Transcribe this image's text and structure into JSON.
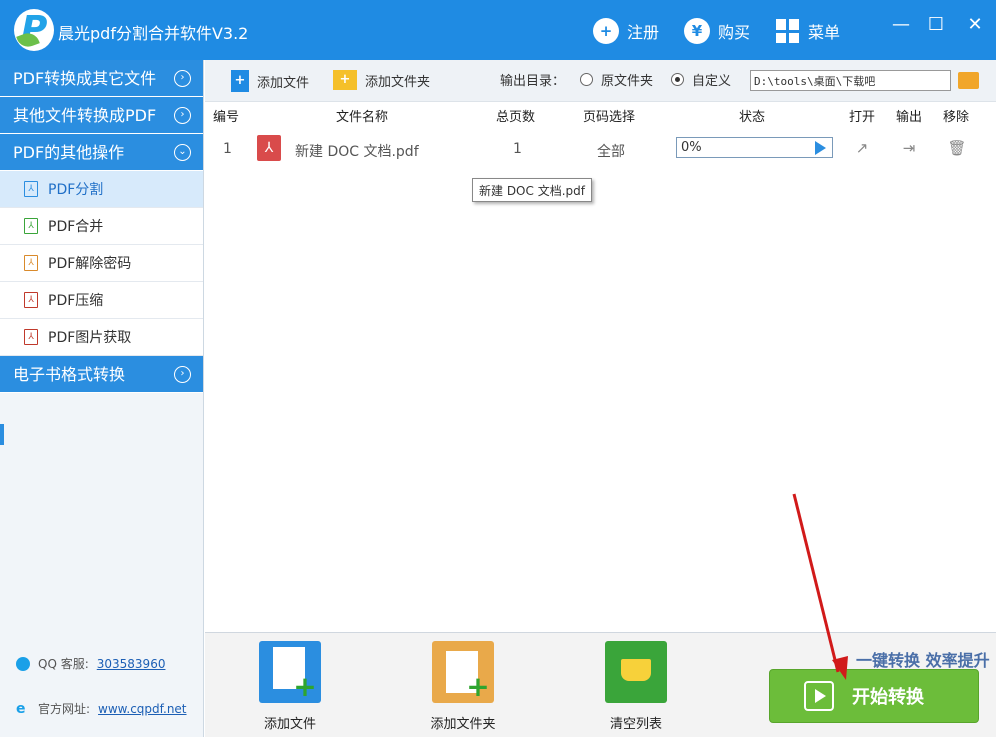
{
  "titlebar": {
    "title": "晨光pdf分割合并软件V3.2",
    "register": "注册",
    "buy": "购买",
    "menu": "菜单",
    "minimize": "—",
    "maximize": "☐",
    "close": "✕"
  },
  "sidebar": {
    "sections": [
      {
        "label": "PDF转换成其它文件"
      },
      {
        "label": "其他文件转换成PDF"
      },
      {
        "label": "PDF的其他操作"
      }
    ],
    "items": [
      {
        "label": "PDF分割"
      },
      {
        "label": "PDF合并"
      },
      {
        "label": "PDF解除密码"
      },
      {
        "label": "PDF压缩"
      },
      {
        "label": "PDF图片获取"
      }
    ],
    "ebook": {
      "label": "电子书格式转换"
    },
    "qq_label": "QQ 客服:",
    "qq_value": "303583960",
    "site_label": "官方网址:",
    "site_value": "www.cqpdf.net"
  },
  "toolbar": {
    "add_file": "添加文件",
    "add_folder": "添加文件夹",
    "output_label": "输出目录：",
    "option_original": "原文件夹",
    "option_custom": "自定义",
    "output_path": "D:\\tools\\桌面\\下载吧"
  },
  "table": {
    "headers": {
      "index": "编号",
      "name": "文件名称",
      "pages": "总页数",
      "range": "页码选择",
      "status": "状态",
      "open": "打开",
      "output": "输出",
      "remove": "移除"
    },
    "rows": [
      {
        "index": "1",
        "name": "新建 DOC 文档.pdf",
        "pages": "1",
        "range": "全部",
        "progress": "0%"
      }
    ],
    "tooltip": "新建 DOC 文档.pdf"
  },
  "bottom": {
    "add_file": "添加文件",
    "add_folder": "添加文件夹",
    "clear_list": "清空列表",
    "slogan": "一键转换  效率提升",
    "start": "开始转换"
  },
  "colors": {
    "brand_blue": "#1f8be3",
    "start_green": "#6cbd3a",
    "annotation_red": "#d11a1a"
  }
}
